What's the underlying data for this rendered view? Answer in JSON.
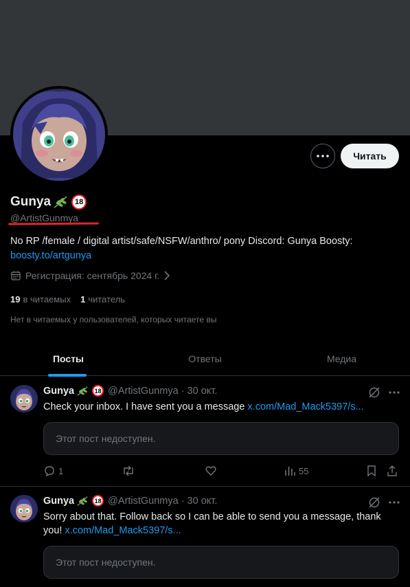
{
  "profile": {
    "display_name": "Gunya",
    "age_badge": "18",
    "handle": "@ArtistGunmya",
    "bio_text": "No RP /female / digital artist/safe/NSFW/anthro/ pony Discord: Gunya Boosty:",
    "bio_link": "boosty.to/artgunya",
    "joined": "Регистрация: сентябрь 2024 г.",
    "following_count": "19",
    "following_label": "в читаемых",
    "followers_count": "1",
    "followers_label": "читатель",
    "followers_note": "Нет в читаемых у пользователей, которых читаете вы",
    "follow_button": "Читать"
  },
  "tabs": [
    {
      "label": "Посты",
      "active": true
    },
    {
      "label": "Ответы",
      "active": false
    },
    {
      "label": "Медиа",
      "active": false
    }
  ],
  "posts": [
    {
      "name": "Gunya",
      "badge": "18",
      "meta": "@ArtistGunmya · 30 окт.",
      "text": "Check your inbox. I have sent you a message ",
      "link": "x.com/Mad_Mack5397/s...",
      "unavailable": "Этот пост недоступен.",
      "replies": "1",
      "views": "55"
    },
    {
      "name": "Gunya",
      "badge": "18",
      "meta": "@ArtistGunmya · 30 окт.",
      "text": "Sorry about that. Follow back so I can be able to send you a message, thank you! ",
      "link": "x.com/Mad_Mack5397/s...",
      "unavailable": "Этот пост недоступен."
    }
  ],
  "colors": {
    "accent": "#1d9bf0",
    "background": "#000000",
    "banner": "#333639",
    "annotation_underline": "#e3232f"
  }
}
